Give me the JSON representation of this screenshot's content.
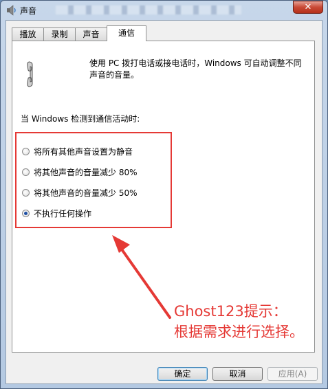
{
  "window": {
    "title": "声音",
    "close_symbol": "✕"
  },
  "tabs": [
    {
      "label": "播放",
      "active": false
    },
    {
      "label": "录制",
      "active": false
    },
    {
      "label": "声音",
      "active": false
    },
    {
      "label": "通信",
      "active": true
    }
  ],
  "panel": {
    "description": "使用 PC 拨打电话或接电话时，Windows 可自动调整不同声音的音量。",
    "group_label": "当 Windows 检测到通信活动时:",
    "options": [
      {
        "label": "将所有其他声音设置为静音",
        "selected": false
      },
      {
        "label": "将其他声音的音量减少 80%",
        "selected": false
      },
      {
        "label": "将其他声音的音量减少 50%",
        "selected": false
      },
      {
        "label": "不执行任何操作",
        "selected": true
      }
    ]
  },
  "annotation": {
    "line1": "Ghost123提示：",
    "line2": "根据需求进行选择。",
    "color": "#e53935"
  },
  "buttons": {
    "ok": "确定",
    "cancel": "取消",
    "apply": "应用(A)"
  },
  "icons": {
    "title": "speaker-icon",
    "phone": "phone-handset-icon"
  }
}
